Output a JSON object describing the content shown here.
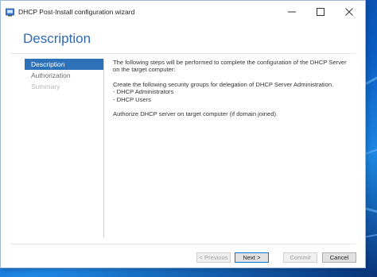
{
  "window": {
    "title": "DHCP Post-Install configuration wizard"
  },
  "page": {
    "heading": "Description"
  },
  "nav": {
    "items": [
      {
        "label": "Description",
        "state": "active"
      },
      {
        "label": "Authorization",
        "state": "normal"
      },
      {
        "label": "Summary",
        "state": "disabled"
      }
    ]
  },
  "content": {
    "intro": "The following steps will be performed to complete the configuration of the DHCP Server on the target computer:",
    "groups_intro": "Create the following security groups for delegation of DHCP Server Administration.",
    "group_1": "- DHCP Administrators",
    "group_2": "- DHCP Users",
    "authorize": "Authorize DHCP server on target computer (if domain joined)."
  },
  "buttons": {
    "previous": "< Previous",
    "next": "Next >",
    "commit": "Commit",
    "cancel": "Cancel"
  },
  "colors": {
    "accent": "#2d72b8",
    "heading": "#2d6bb0"
  },
  "icons": {
    "app": "dhcp-wizard-icon",
    "minimize": "minimize-icon",
    "maximize": "maximize-icon",
    "close": "close-icon"
  }
}
